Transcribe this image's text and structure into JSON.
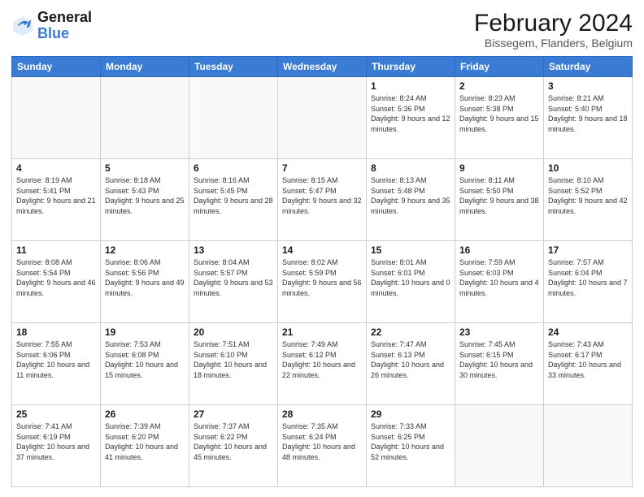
{
  "logo": {
    "general": "General",
    "blue": "Blue"
  },
  "header": {
    "month": "February 2024",
    "location": "Bissegem, Flanders, Belgium"
  },
  "days_of_week": [
    "Sunday",
    "Monday",
    "Tuesday",
    "Wednesday",
    "Thursday",
    "Friday",
    "Saturday"
  ],
  "weeks": [
    [
      {
        "day": "",
        "info": ""
      },
      {
        "day": "",
        "info": ""
      },
      {
        "day": "",
        "info": ""
      },
      {
        "day": "",
        "info": ""
      },
      {
        "day": "1",
        "info": "Sunrise: 8:24 AM\nSunset: 5:36 PM\nDaylight: 9 hours\nand 12 minutes."
      },
      {
        "day": "2",
        "info": "Sunrise: 8:23 AM\nSunset: 5:38 PM\nDaylight: 9 hours\nand 15 minutes."
      },
      {
        "day": "3",
        "info": "Sunrise: 8:21 AM\nSunset: 5:40 PM\nDaylight: 9 hours\nand 18 minutes."
      }
    ],
    [
      {
        "day": "4",
        "info": "Sunrise: 8:19 AM\nSunset: 5:41 PM\nDaylight: 9 hours\nand 21 minutes."
      },
      {
        "day": "5",
        "info": "Sunrise: 8:18 AM\nSunset: 5:43 PM\nDaylight: 9 hours\nand 25 minutes."
      },
      {
        "day": "6",
        "info": "Sunrise: 8:16 AM\nSunset: 5:45 PM\nDaylight: 9 hours\nand 28 minutes."
      },
      {
        "day": "7",
        "info": "Sunrise: 8:15 AM\nSunset: 5:47 PM\nDaylight: 9 hours\nand 32 minutes."
      },
      {
        "day": "8",
        "info": "Sunrise: 8:13 AM\nSunset: 5:48 PM\nDaylight: 9 hours\nand 35 minutes."
      },
      {
        "day": "9",
        "info": "Sunrise: 8:11 AM\nSunset: 5:50 PM\nDaylight: 9 hours\nand 38 minutes."
      },
      {
        "day": "10",
        "info": "Sunrise: 8:10 AM\nSunset: 5:52 PM\nDaylight: 9 hours\nand 42 minutes."
      }
    ],
    [
      {
        "day": "11",
        "info": "Sunrise: 8:08 AM\nSunset: 5:54 PM\nDaylight: 9 hours\nand 46 minutes."
      },
      {
        "day": "12",
        "info": "Sunrise: 8:06 AM\nSunset: 5:56 PM\nDaylight: 9 hours\nand 49 minutes."
      },
      {
        "day": "13",
        "info": "Sunrise: 8:04 AM\nSunset: 5:57 PM\nDaylight: 9 hours\nand 53 minutes."
      },
      {
        "day": "14",
        "info": "Sunrise: 8:02 AM\nSunset: 5:59 PM\nDaylight: 9 hours\nand 56 minutes."
      },
      {
        "day": "15",
        "info": "Sunrise: 8:01 AM\nSunset: 6:01 PM\nDaylight: 10 hours\nand 0 minutes."
      },
      {
        "day": "16",
        "info": "Sunrise: 7:59 AM\nSunset: 6:03 PM\nDaylight: 10 hours\nand 4 minutes."
      },
      {
        "day": "17",
        "info": "Sunrise: 7:57 AM\nSunset: 6:04 PM\nDaylight: 10 hours\nand 7 minutes."
      }
    ],
    [
      {
        "day": "18",
        "info": "Sunrise: 7:55 AM\nSunset: 6:06 PM\nDaylight: 10 hours\nand 11 minutes."
      },
      {
        "day": "19",
        "info": "Sunrise: 7:53 AM\nSunset: 6:08 PM\nDaylight: 10 hours\nand 15 minutes."
      },
      {
        "day": "20",
        "info": "Sunrise: 7:51 AM\nSunset: 6:10 PM\nDaylight: 10 hours\nand 18 minutes."
      },
      {
        "day": "21",
        "info": "Sunrise: 7:49 AM\nSunset: 6:12 PM\nDaylight: 10 hours\nand 22 minutes."
      },
      {
        "day": "22",
        "info": "Sunrise: 7:47 AM\nSunset: 6:13 PM\nDaylight: 10 hours\nand 26 minutes."
      },
      {
        "day": "23",
        "info": "Sunrise: 7:45 AM\nSunset: 6:15 PM\nDaylight: 10 hours\nand 30 minutes."
      },
      {
        "day": "24",
        "info": "Sunrise: 7:43 AM\nSunset: 6:17 PM\nDaylight: 10 hours\nand 33 minutes."
      }
    ],
    [
      {
        "day": "25",
        "info": "Sunrise: 7:41 AM\nSunset: 6:19 PM\nDaylight: 10 hours\nand 37 minutes."
      },
      {
        "day": "26",
        "info": "Sunrise: 7:39 AM\nSunset: 6:20 PM\nDaylight: 10 hours\nand 41 minutes."
      },
      {
        "day": "27",
        "info": "Sunrise: 7:37 AM\nSunset: 6:22 PM\nDaylight: 10 hours\nand 45 minutes."
      },
      {
        "day": "28",
        "info": "Sunrise: 7:35 AM\nSunset: 6:24 PM\nDaylight: 10 hours\nand 48 minutes."
      },
      {
        "day": "29",
        "info": "Sunrise: 7:33 AM\nSunset: 6:25 PM\nDaylight: 10 hours\nand 52 minutes."
      },
      {
        "day": "",
        "info": ""
      },
      {
        "day": "",
        "info": ""
      }
    ]
  ]
}
